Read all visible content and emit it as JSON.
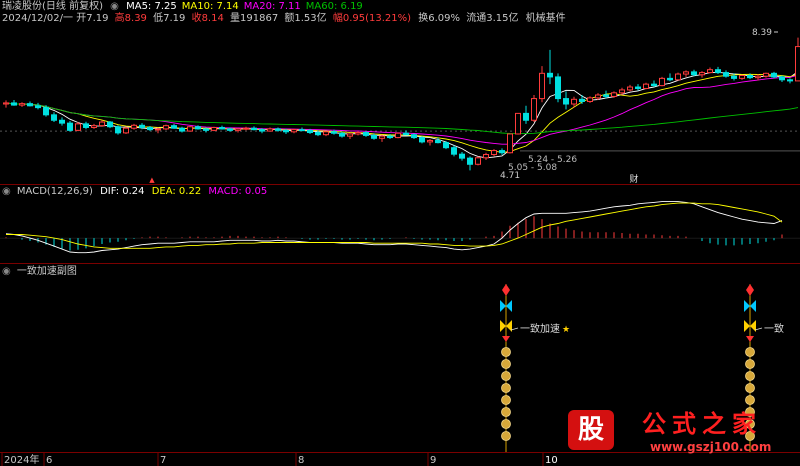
{
  "header": {
    "title": "瑞凌股份(日线 前复权)",
    "ma_labels": [
      {
        "text": "MA5: 7.25",
        "color": "#ffffff"
      },
      {
        "text": "MA10: 7.14",
        "color": "#ffff00"
      },
      {
        "text": "MA20: 7.11",
        "color": "#ff00ff"
      },
      {
        "text": "MA60: 6.19",
        "color": "#00c000"
      }
    ]
  },
  "quote": {
    "date": "2024/12/02/一",
    "open_label": "开",
    "open": "7.19",
    "high_label": "高",
    "high": "8.39",
    "low_label": "低",
    "low": "7.19",
    "close_label": "收",
    "close": "8.14",
    "volume_label": "量",
    "volume": "191867",
    "amount_label": "额",
    "amount": "1.53亿",
    "change_label": "幅",
    "change": "0.95(13.21%)",
    "turnover_label": "换",
    "turnover": "6.09%",
    "float_label": "流通",
    "float": "3.15亿",
    "sector": "机械基件"
  },
  "macd_header": {
    "name": "MACD(12,26,9)",
    "dif": "DIF: 0.24",
    "dea": "DEA: 0.22",
    "macd": "MACD: 0.05"
  },
  "indicator_header": {
    "name": "一致加速副图"
  },
  "annotations": {
    "max_price": "8.39",
    "low_price": "4.71",
    "range_a": "5.24 - 5.26",
    "range_b": "5.05 - 5.08",
    "marker": "财",
    "signal_label": "一致加速",
    "signal_label_cut": "一致"
  },
  "x_axis": {
    "labels": [
      "2024年",
      "6",
      "7",
      "8",
      "9",
      "10"
    ]
  },
  "watermark": {
    "icon_text": "股",
    "site_name": "公式之家",
    "url": "www.gszj100.com"
  },
  "colors": {
    "up": "#ff3c3c",
    "down": "#00e0e0",
    "ma5": "#ffffff",
    "ma10": "#ffff00",
    "ma20": "#ff00ff",
    "ma60": "#00c000"
  },
  "chart_data": {
    "type": "candlestick",
    "price_range": [
      4.5,
      8.6
    ],
    "candles": [
      {
        "o": 6.55,
        "h": 6.65,
        "l": 6.45,
        "c": 6.58
      },
      {
        "o": 6.58,
        "h": 6.66,
        "l": 6.5,
        "c": 6.52
      },
      {
        "o": 6.52,
        "h": 6.6,
        "l": 6.47,
        "c": 6.56
      },
      {
        "o": 6.56,
        "h": 6.62,
        "l": 6.48,
        "c": 6.5
      },
      {
        "o": 6.5,
        "h": 6.58,
        "l": 6.4,
        "c": 6.45
      },
      {
        "o": 6.45,
        "h": 6.52,
        "l": 6.2,
        "c": 6.25
      },
      {
        "o": 6.25,
        "h": 6.32,
        "l": 6.05,
        "c": 6.1
      },
      {
        "o": 6.1,
        "h": 6.18,
        "l": 5.95,
        "c": 6.02
      },
      {
        "o": 6.02,
        "h": 6.08,
        "l": 5.78,
        "c": 5.82
      },
      {
        "o": 5.82,
        "h": 6.05,
        "l": 5.8,
        "c": 6.0
      },
      {
        "o": 6.0,
        "h": 6.06,
        "l": 5.85,
        "c": 5.9
      },
      {
        "o": 5.9,
        "h": 6.0,
        "l": 5.86,
        "c": 5.95
      },
      {
        "o": 5.95,
        "h": 6.1,
        "l": 5.92,
        "c": 6.05
      },
      {
        "o": 6.05,
        "h": 6.08,
        "l": 5.88,
        "c": 5.92
      },
      {
        "o": 5.92,
        "h": 5.96,
        "l": 5.7,
        "c": 5.75
      },
      {
        "o": 5.75,
        "h": 5.92,
        "l": 5.72,
        "c": 5.88
      },
      {
        "o": 5.88,
        "h": 6.0,
        "l": 5.84,
        "c": 5.96
      },
      {
        "o": 5.96,
        "h": 6.02,
        "l": 5.85,
        "c": 5.9
      },
      {
        "o": 5.9,
        "h": 5.94,
        "l": 5.8,
        "c": 5.84
      },
      {
        "o": 5.84,
        "h": 5.9,
        "l": 5.74,
        "c": 5.86
      },
      {
        "o": 5.86,
        "h": 5.98,
        "l": 5.83,
        "c": 5.95
      },
      {
        "o": 5.95,
        "h": 6.0,
        "l": 5.86,
        "c": 5.88
      },
      {
        "o": 5.88,
        "h": 5.92,
        "l": 5.76,
        "c": 5.8
      },
      {
        "o": 5.8,
        "h": 5.94,
        "l": 5.78,
        "c": 5.92
      },
      {
        "o": 5.92,
        "h": 5.96,
        "l": 5.84,
        "c": 5.86
      },
      {
        "o": 5.86,
        "h": 5.9,
        "l": 5.76,
        "c": 5.82
      },
      {
        "o": 5.82,
        "h": 5.92,
        "l": 5.8,
        "c": 5.9
      },
      {
        "o": 5.9,
        "h": 5.95,
        "l": 5.84,
        "c": 5.86
      },
      {
        "o": 5.86,
        "h": 5.9,
        "l": 5.78,
        "c": 5.82
      },
      {
        "o": 5.82,
        "h": 5.88,
        "l": 5.76,
        "c": 5.86
      },
      {
        "o": 5.86,
        "h": 5.92,
        "l": 5.82,
        "c": 5.88
      },
      {
        "o": 5.88,
        "h": 5.93,
        "l": 5.82,
        "c": 5.84
      },
      {
        "o": 5.84,
        "h": 5.88,
        "l": 5.74,
        "c": 5.8
      },
      {
        "o": 5.8,
        "h": 5.9,
        "l": 5.78,
        "c": 5.86
      },
      {
        "o": 5.86,
        "h": 5.9,
        "l": 5.78,
        "c": 5.82
      },
      {
        "o": 5.82,
        "h": 5.86,
        "l": 5.72,
        "c": 5.78
      },
      {
        "o": 5.78,
        "h": 5.86,
        "l": 5.74,
        "c": 5.84
      },
      {
        "o": 5.84,
        "h": 5.9,
        "l": 5.8,
        "c": 5.82
      },
      {
        "o": 5.82,
        "h": 5.86,
        "l": 5.72,
        "c": 5.76
      },
      {
        "o": 5.76,
        "h": 5.82,
        "l": 5.66,
        "c": 5.7
      },
      {
        "o": 5.7,
        "h": 5.8,
        "l": 5.66,
        "c": 5.78
      },
      {
        "o": 5.78,
        "h": 5.84,
        "l": 5.7,
        "c": 5.74
      },
      {
        "o": 5.74,
        "h": 5.78,
        "l": 5.62,
        "c": 5.66
      },
      {
        "o": 5.66,
        "h": 5.74,
        "l": 5.58,
        "c": 5.72
      },
      {
        "o": 5.72,
        "h": 5.8,
        "l": 5.68,
        "c": 5.76
      },
      {
        "o": 5.76,
        "h": 5.8,
        "l": 5.64,
        "c": 5.68
      },
      {
        "o": 5.68,
        "h": 5.74,
        "l": 5.56,
        "c": 5.6
      },
      {
        "o": 5.6,
        "h": 5.7,
        "l": 5.5,
        "c": 5.66
      },
      {
        "o": 5.66,
        "h": 5.72,
        "l": 5.58,
        "c": 5.62
      },
      {
        "o": 5.62,
        "h": 5.76,
        "l": 5.6,
        "c": 5.74
      },
      {
        "o": 5.74,
        "h": 5.82,
        "l": 5.68,
        "c": 5.7
      },
      {
        "o": 5.7,
        "h": 5.74,
        "l": 5.58,
        "c": 5.62
      },
      {
        "o": 5.62,
        "h": 5.66,
        "l": 5.46,
        "c": 5.5
      },
      {
        "o": 5.5,
        "h": 5.58,
        "l": 5.4,
        "c": 5.54
      },
      {
        "o": 5.54,
        "h": 5.62,
        "l": 5.46,
        "c": 5.48
      },
      {
        "o": 5.48,
        "h": 5.52,
        "l": 5.3,
        "c": 5.34
      },
      {
        "o": 5.34,
        "h": 5.4,
        "l": 5.1,
        "c": 5.16
      },
      {
        "o": 5.16,
        "h": 5.22,
        "l": 4.98,
        "c": 5.05
      },
      {
        "o": 5.05,
        "h": 5.1,
        "l": 4.71,
        "c": 4.88
      },
      {
        "o": 4.88,
        "h": 5.1,
        "l": 4.85,
        "c": 5.06
      },
      {
        "o": 5.06,
        "h": 5.2,
        "l": 5.0,
        "c": 5.15
      },
      {
        "o": 5.15,
        "h": 5.3,
        "l": 5.1,
        "c": 5.26
      },
      {
        "o": 5.26,
        "h": 5.32,
        "l": 5.14,
        "c": 5.2
      },
      {
        "o": 5.2,
        "h": 5.72,
        "l": 5.18,
        "c": 5.72
      },
      {
        "o": 5.72,
        "h": 6.29,
        "l": 5.7,
        "c": 6.29
      },
      {
        "o": 6.29,
        "h": 6.5,
        "l": 6.0,
        "c": 6.1
      },
      {
        "o": 6.1,
        "h": 6.8,
        "l": 6.05,
        "c": 6.7
      },
      {
        "o": 6.7,
        "h": 7.6,
        "l": 6.6,
        "c": 7.4
      },
      {
        "o": 7.4,
        "h": 8.05,
        "l": 7.1,
        "c": 7.3
      },
      {
        "o": 7.3,
        "h": 7.4,
        "l": 6.6,
        "c": 6.7
      },
      {
        "o": 6.7,
        "h": 6.9,
        "l": 6.4,
        "c": 6.55
      },
      {
        "o": 6.55,
        "h": 6.75,
        "l": 6.45,
        "c": 6.68
      },
      {
        "o": 6.68,
        "h": 6.8,
        "l": 6.55,
        "c": 6.62
      },
      {
        "o": 6.62,
        "h": 6.76,
        "l": 6.58,
        "c": 6.72
      },
      {
        "o": 6.72,
        "h": 6.85,
        "l": 6.66,
        "c": 6.8
      },
      {
        "o": 6.8,
        "h": 6.92,
        "l": 6.7,
        "c": 6.76
      },
      {
        "o": 6.76,
        "h": 6.9,
        "l": 6.72,
        "c": 6.86
      },
      {
        "o": 6.86,
        "h": 7.0,
        "l": 6.8,
        "c": 6.94
      },
      {
        "o": 6.94,
        "h": 7.08,
        "l": 6.9,
        "c": 7.02
      },
      {
        "o": 7.02,
        "h": 7.1,
        "l": 6.92,
        "c": 6.98
      },
      {
        "o": 6.98,
        "h": 7.14,
        "l": 6.96,
        "c": 7.1
      },
      {
        "o": 7.1,
        "h": 7.2,
        "l": 7.02,
        "c": 7.06
      },
      {
        "o": 7.06,
        "h": 7.3,
        "l": 7.04,
        "c": 7.26
      },
      {
        "o": 7.26,
        "h": 7.4,
        "l": 7.18,
        "c": 7.22
      },
      {
        "o": 7.22,
        "h": 7.42,
        "l": 7.2,
        "c": 7.38
      },
      {
        "o": 7.38,
        "h": 7.48,
        "l": 7.3,
        "c": 7.44
      },
      {
        "o": 7.44,
        "h": 7.5,
        "l": 7.32,
        "c": 7.36
      },
      {
        "o": 7.36,
        "h": 7.46,
        "l": 7.28,
        "c": 7.42
      },
      {
        "o": 7.42,
        "h": 7.56,
        "l": 7.4,
        "c": 7.5
      },
      {
        "o": 7.5,
        "h": 7.58,
        "l": 7.38,
        "c": 7.42
      },
      {
        "o": 7.42,
        "h": 7.48,
        "l": 7.28,
        "c": 7.32
      },
      {
        "o": 7.32,
        "h": 7.4,
        "l": 7.2,
        "c": 7.26
      },
      {
        "o": 7.26,
        "h": 7.36,
        "l": 7.22,
        "c": 7.34
      },
      {
        "o": 7.34,
        "h": 7.4,
        "l": 7.24,
        "c": 7.28
      },
      {
        "o": 7.28,
        "h": 7.38,
        "l": 7.2,
        "c": 7.32
      },
      {
        "o": 7.32,
        "h": 7.42,
        "l": 7.28,
        "c": 7.4
      },
      {
        "o": 7.4,
        "h": 7.44,
        "l": 7.26,
        "c": 7.3
      },
      {
        "o": 7.3,
        "h": 7.34,
        "l": 7.16,
        "c": 7.22
      },
      {
        "o": 7.22,
        "h": 7.26,
        "l": 7.12,
        "c": 7.19
      },
      {
        "o": 7.19,
        "h": 8.39,
        "l": 7.19,
        "c": 8.14
      }
    ],
    "macd_range": [
      -0.3,
      0.55
    ],
    "macd_bars": [
      0.01,
      0.0,
      -0.02,
      -0.04,
      -0.06,
      -0.09,
      -0.12,
      -0.15,
      -0.17,
      -0.16,
      -0.14,
      -0.11,
      -0.08,
      -0.06,
      -0.05,
      -0.03,
      -0.01,
      0.01,
      0.02,
      0.02,
      0.01,
      0.0,
      0.01,
      0.02,
      0.02,
      0.01,
      0.01,
      0.02,
      0.03,
      0.03,
      0.02,
      0.02,
      0.01,
      0.01,
      0.02,
      0.01,
      0.0,
      -0.01,
      -0.02,
      -0.02,
      -0.01,
      -0.01,
      -0.02,
      -0.02,
      -0.01,
      -0.02,
      -0.03,
      -0.02,
      -0.01,
      0.0,
      0.01,
      -0.01,
      -0.02,
      -0.02,
      -0.03,
      -0.03,
      -0.04,
      -0.04,
      -0.02,
      0.0,
      0.02,
      0.03,
      0.09,
      0.17,
      0.21,
      0.26,
      0.3,
      0.26,
      0.2,
      0.16,
      0.13,
      0.11,
      0.09,
      0.08,
      0.08,
      0.08,
      0.08,
      0.07,
      0.06,
      0.06,
      0.05,
      0.05,
      0.04,
      0.03,
      0.03,
      0.02,
      0.0,
      -0.04,
      -0.07,
      -0.09,
      -0.1,
      -0.1,
      -0.09,
      -0.08,
      -0.07,
      -0.05,
      -0.03,
      0.05
    ],
    "dif": [
      0.06,
      0.05,
      0.03,
      0.0,
      -0.03,
      -0.07,
      -0.11,
      -0.15,
      -0.19,
      -0.2,
      -0.2,
      -0.19,
      -0.17,
      -0.16,
      -0.15,
      -0.13,
      -0.11,
      -0.09,
      -0.08,
      -0.07,
      -0.07,
      -0.07,
      -0.06,
      -0.05,
      -0.05,
      -0.05,
      -0.05,
      -0.04,
      -0.03,
      -0.03,
      -0.03,
      -0.03,
      -0.04,
      -0.04,
      -0.03,
      -0.04,
      -0.04,
      -0.05,
      -0.06,
      -0.06,
      -0.06,
      -0.06,
      -0.07,
      -0.07,
      -0.07,
      -0.08,
      -0.09,
      -0.09,
      -0.09,
      -0.08,
      -0.08,
      -0.09,
      -0.1,
      -0.11,
      -0.12,
      -0.13,
      -0.15,
      -0.16,
      -0.15,
      -0.13,
      -0.11,
      -0.08,
      0.0,
      0.11,
      0.2,
      0.28,
      0.33,
      0.34,
      0.34,
      0.34,
      0.34,
      0.35,
      0.36,
      0.37,
      0.39,
      0.41,
      0.43,
      0.44,
      0.45,
      0.47,
      0.48,
      0.49,
      0.5,
      0.5,
      0.5,
      0.49,
      0.47,
      0.43,
      0.39,
      0.35,
      0.32,
      0.29,
      0.26,
      0.24,
      0.22,
      0.21,
      0.2,
      0.24
    ],
    "dea": [
      0.05,
      0.05,
      0.05,
      0.04,
      0.03,
      0.02,
      0.0,
      -0.02,
      -0.05,
      -0.08,
      -0.1,
      -0.12,
      -0.13,
      -0.14,
      -0.14,
      -0.14,
      -0.14,
      -0.14,
      -0.14,
      -0.13,
      -0.12,
      -0.12,
      -0.11,
      -0.1,
      -0.1,
      -0.09,
      -0.09,
      -0.08,
      -0.08,
      -0.07,
      -0.07,
      -0.07,
      -0.06,
      -0.06,
      -0.06,
      -0.06,
      -0.06,
      -0.06,
      -0.06,
      -0.06,
      -0.06,
      -0.06,
      -0.06,
      -0.06,
      -0.06,
      -0.06,
      -0.07,
      -0.07,
      -0.07,
      -0.07,
      -0.07,
      -0.07,
      -0.07,
      -0.08,
      -0.08,
      -0.09,
      -0.1,
      -0.1,
      -0.11,
      -0.11,
      -0.11,
      -0.1,
      -0.08,
      -0.04,
      0.0,
      0.05,
      0.1,
      0.15,
      0.18,
      0.2,
      0.23,
      0.25,
      0.27,
      0.29,
      0.31,
      0.33,
      0.35,
      0.37,
      0.39,
      0.41,
      0.43,
      0.44,
      0.46,
      0.47,
      0.48,
      0.48,
      0.48,
      0.47,
      0.47,
      0.46,
      0.44,
      0.42,
      0.4,
      0.38,
      0.36,
      0.33,
      0.3,
      0.22
    ],
    "signal_columns": [
      {
        "index": 64
      },
      {
        "index": 95
      }
    ]
  }
}
